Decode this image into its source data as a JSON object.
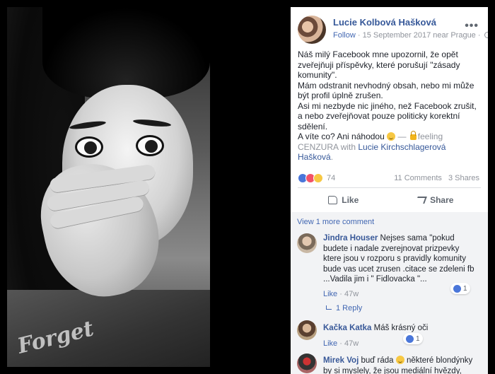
{
  "post": {
    "author": "Lucie Kolbová Hašková",
    "follow": "Follow",
    "date_location": "· 15 September 2017 near Prague ·",
    "text_lines": [
      "Náš milý Facebook mne upozornil, že opět zveřejňuji příspěvky, které porušují \"zásady komunity\".",
      "Mám odstranit nevhodný obsah, nebo mi může být profil úplně zrušen.",
      "Asi mi nezbyde nic jiného, než Facebook zrušit, a nebo zveřejňovat pouze politicky korektní sdělení."
    ],
    "last_line_start": "A víte co? Ani náhodou",
    "feeling_prefix": "— ",
    "feeling": "feeling CENZURA",
    "with_word": "with",
    "tagged": "Lucie Kirchschlagerová Hašková",
    "tagged_end": ".",
    "reaction_count": "74",
    "comments_count": "11 Comments",
    "shares_count": "3 Shares",
    "like_label": "Like",
    "share_label": "Share",
    "shirt_text": "Forget"
  },
  "comments": {
    "view_more": "View 1 more comment",
    "items": [
      {
        "name": "Jindra Houser",
        "text": "Nejses sama \"pokud budete i nadale zverejnovat prizpevky ktere jsou v rozporu s pravidly komunity bude vas ucet zrusen .citace se zdeleni fb ...Vadila jim i \" Fidlovacka \"...",
        "like": "Like",
        "time": "47w",
        "reactions": "1",
        "reply": "1 Reply"
      },
      {
        "name": "Kačka Katka",
        "text": "Máš krásný oči",
        "like": "Like",
        "time": "47w",
        "reactions": "1"
      },
      {
        "name": "Mirek Voj",
        "text_start": "buď ráda",
        "text_end": "některé blondýnky by si myslely, že jsou mediální hvězdy, když"
      }
    ]
  },
  "colors": {
    "link": "#365899",
    "accent": "#4267b2",
    "muted": "#90949c",
    "background": "#000000"
  }
}
